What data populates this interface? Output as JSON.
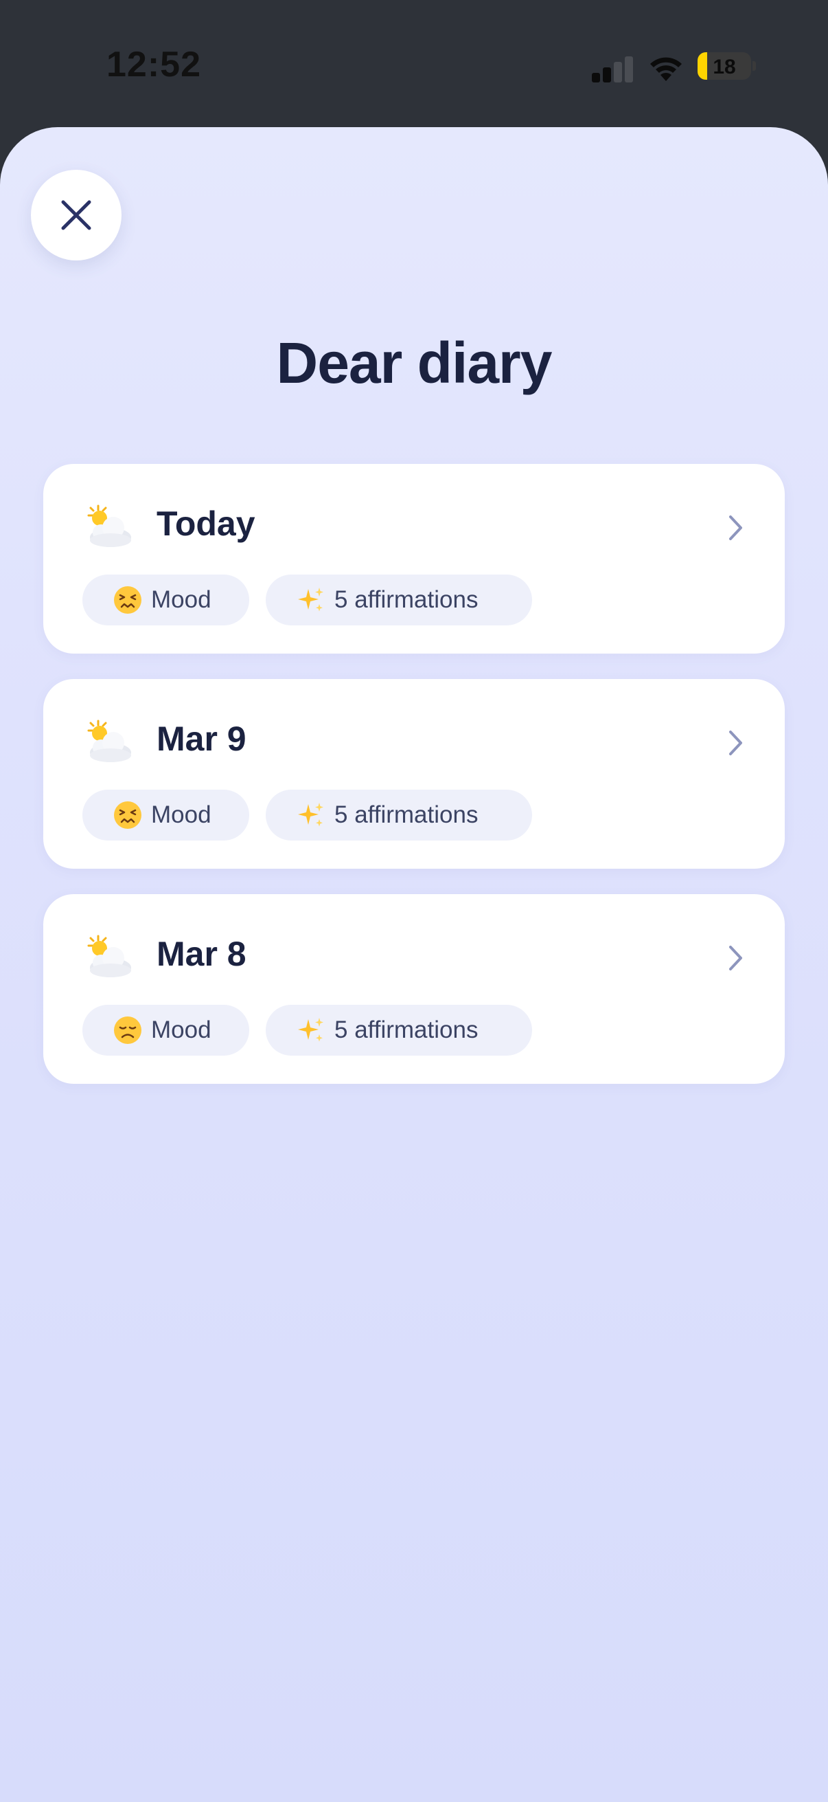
{
  "status_bar": {
    "time": "12:52",
    "battery_level": "18"
  },
  "sheet": {
    "title": "Dear diary",
    "entries": [
      {
        "date_label": "Today",
        "weather_icon": "sun-behind-cloud-icon",
        "mood_icon": "confounded-face-icon",
        "mood_label": "Mood",
        "affirmations_label": "5 affirmations"
      },
      {
        "date_label": "Mar 9",
        "weather_icon": "sun-behind-cloud-icon",
        "mood_icon": "confounded-face-icon",
        "mood_label": "Mood",
        "affirmations_label": "5 affirmations"
      },
      {
        "date_label": "Mar 8",
        "weather_icon": "sun-behind-cloud-icon",
        "mood_icon": "disappointed-face-icon",
        "mood_label": "Mood",
        "affirmations_label": "5 affirmations"
      }
    ]
  },
  "colors": {
    "title_text": "#1b2240",
    "chip_background": "#eef0fa",
    "sheet_background": "#e0e3fd",
    "battery_fill": "#ffd400"
  }
}
